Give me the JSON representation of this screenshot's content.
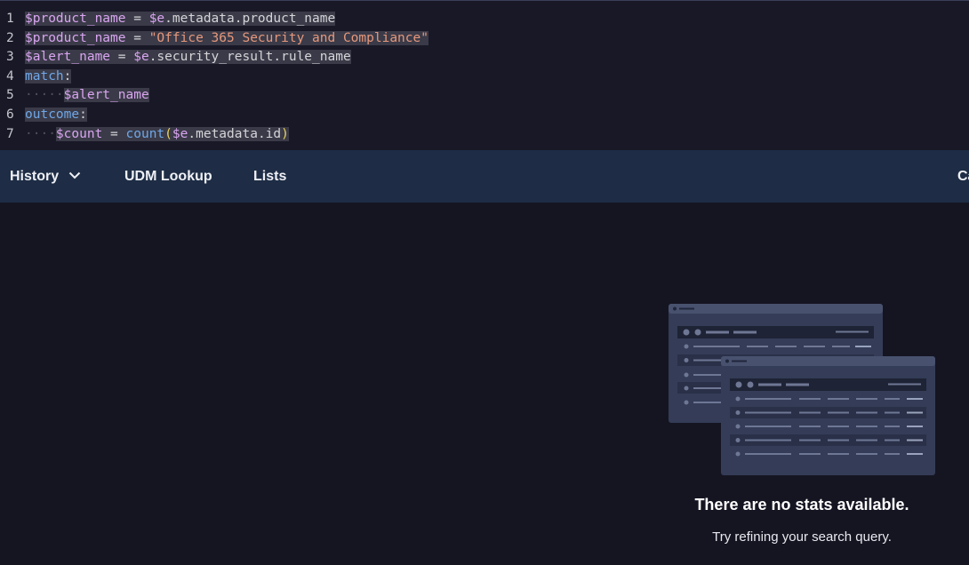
{
  "editor": {
    "lines": [
      {
        "num": "1",
        "tokens": [
          {
            "t": "$product_name",
            "c": "v"
          },
          {
            "t": " = ",
            "c": "t"
          },
          {
            "t": "$e",
            "c": "v"
          },
          {
            "t": ".metadata.product_name",
            "c": "t"
          }
        ]
      },
      {
        "num": "2",
        "tokens": [
          {
            "t": "$product_name",
            "c": "v"
          },
          {
            "t": " = ",
            "c": "t"
          },
          {
            "t": "\"Office 365 Security and Compliance\"",
            "c": "s"
          }
        ]
      },
      {
        "num": "3",
        "tokens": [
          {
            "t": "$alert_name",
            "c": "v"
          },
          {
            "t": " = ",
            "c": "t"
          },
          {
            "t": "$e",
            "c": "v"
          },
          {
            "t": ".security_result.rule_name",
            "c": "t"
          }
        ]
      },
      {
        "num": "4",
        "tokens": [
          {
            "t": "match",
            "c": "k"
          },
          {
            "t": ":",
            "c": "t"
          }
        ]
      },
      {
        "num": "5",
        "tokens": [
          {
            "t": "·····",
            "c": "ws"
          },
          {
            "t": "$alert_name",
            "c": "v"
          }
        ]
      },
      {
        "num": "6",
        "tokens": [
          {
            "t": "outcome",
            "c": "k"
          },
          {
            "t": ":",
            "c": "t"
          }
        ]
      },
      {
        "num": "7",
        "tokens": [
          {
            "t": "····",
            "c": "ws"
          },
          {
            "t": "$count",
            "c": "v"
          },
          {
            "t": " = ",
            "c": "t"
          },
          {
            "t": "count",
            "c": "f"
          },
          {
            "t": "(",
            "c": "p"
          },
          {
            "t": "$e",
            "c": "v"
          },
          {
            "t": ".metadata.id",
            "c": "t"
          },
          {
            "t": ")",
            "c": "p"
          }
        ]
      }
    ]
  },
  "tabs": {
    "history": "History",
    "udm_lookup": "UDM Lookup",
    "lists": "Lists",
    "cut": "Ca"
  },
  "empty_state": {
    "title": "There are no stats available.",
    "subtitle": "Try refining your search query."
  }
}
